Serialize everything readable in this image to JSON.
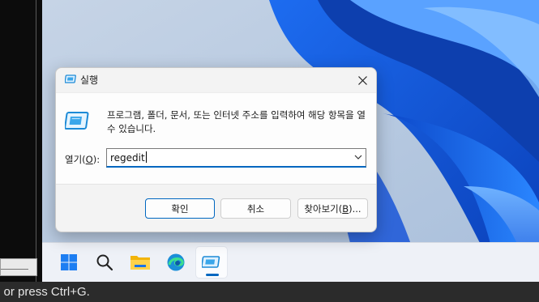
{
  "dialog": {
    "title": "실행",
    "description": "프로그램, 폴더, 문서, 또는 인터넷 주소를 입력하여 해당 항목을 열 수 있습니다.",
    "open_label_prefix": "열기(",
    "open_label_key": "O",
    "open_label_suffix": "):",
    "input_value": "regedit",
    "ok_label": "확인",
    "cancel_label": "취소",
    "browse_prefix": "찾아보기(",
    "browse_key": "B",
    "browse_suffix": ")..."
  },
  "taskbar": {
    "items": [
      {
        "name": "start-button",
        "icon": "windows-logo-icon"
      },
      {
        "name": "search-button",
        "icon": "search-icon"
      },
      {
        "name": "file-explorer-button",
        "icon": "folder-icon"
      },
      {
        "name": "edge-button",
        "icon": "edge-icon"
      },
      {
        "name": "run-button",
        "icon": "run-icon",
        "active": true
      }
    ]
  },
  "statusbar": {
    "text": "e or press Ctrl+G."
  },
  "colors": {
    "accent": "#0067c0",
    "wallpaper_blue": "#0a52d6"
  }
}
